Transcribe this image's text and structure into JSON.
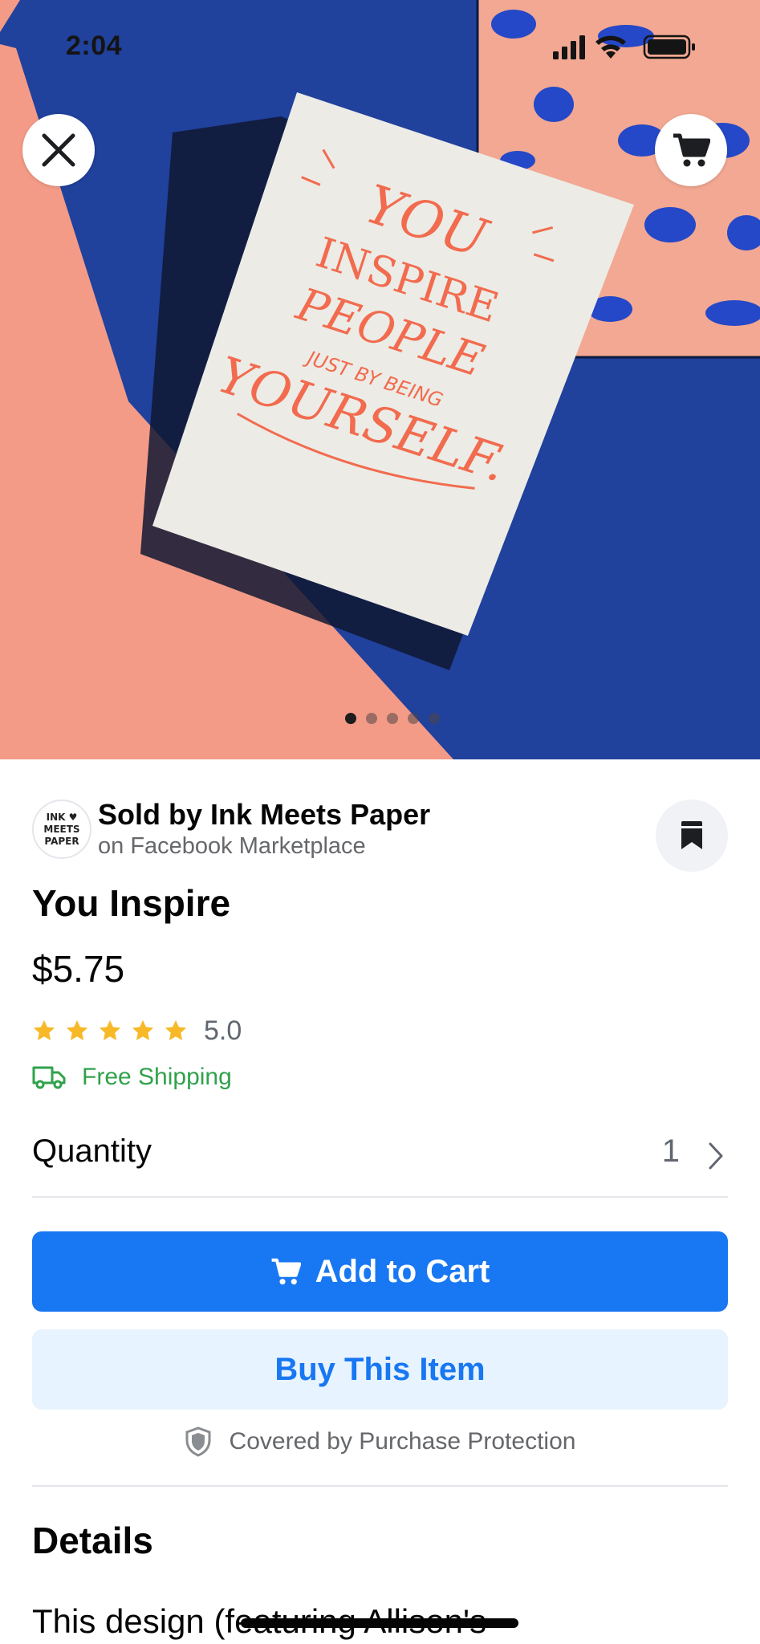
{
  "status_bar": {
    "time": "2:04"
  },
  "hero": {
    "card_text": [
      "YOU",
      "INSPIRE",
      "PEOPLE",
      "JUST BY BEING",
      "YOURSELF."
    ],
    "page_dots": 5,
    "active_dot": 0,
    "close_icon": "close-icon",
    "cart_icon": "shopping-cart-icon"
  },
  "seller": {
    "logo_lines": [
      "INK ♥",
      "MEETS",
      "PAPER"
    ],
    "name": "Sold by Ink Meets Paper",
    "subtitle": "on Facebook Marketplace",
    "save_icon": "bookmark-icon"
  },
  "product": {
    "title": "You Inspire",
    "price": "$5.75",
    "rating": "5.0",
    "stars": 5,
    "shipping": "Free Shipping"
  },
  "quantity": {
    "label": "Quantity",
    "value": "1"
  },
  "buttons": {
    "add_to_cart": "Add to Cart",
    "buy": "Buy This Item"
  },
  "protection": "Covered by Purchase Protection",
  "details": {
    "heading": "Details",
    "text": "This design (featuring Allison's"
  },
  "colors": {
    "accent": "#1877f2",
    "accent_light": "#e7f3ff",
    "shipping_green": "#31a24c",
    "star_yellow": "#f7b928",
    "card_lettering": "#f26b4e"
  }
}
